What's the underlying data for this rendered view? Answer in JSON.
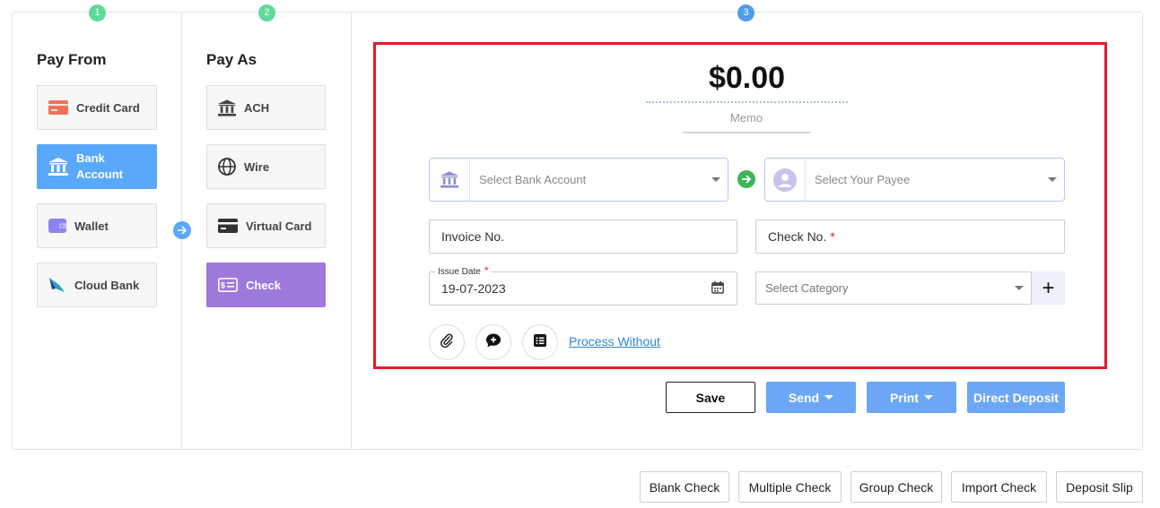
{
  "steps": [
    "1",
    "2",
    "3"
  ],
  "pay_from": {
    "title": "Pay From",
    "options": [
      {
        "label": "Credit Card",
        "icon": "credit-card-icon"
      },
      {
        "label_line1": "Bank",
        "label_line2": "Account",
        "icon": "bank-icon",
        "selected": true
      },
      {
        "label": "Wallet",
        "icon": "wallet-icon"
      },
      {
        "label": "Cloud Bank",
        "icon": "cloud-bank-icon"
      }
    ]
  },
  "pay_as": {
    "title": "Pay As",
    "options": [
      {
        "label": "ACH",
        "icon": "bank-icon"
      },
      {
        "label": "Wire",
        "icon": "globe-icon"
      },
      {
        "label": "Virtual Card",
        "icon": "card-icon"
      },
      {
        "label": "Check",
        "icon": "check-icon",
        "selected": true
      }
    ]
  },
  "form": {
    "amount": "$0.00",
    "memo_placeholder": "Memo",
    "bank_account_placeholder": "Select Bank Account",
    "payee_placeholder": "Select Your Payee",
    "invoice_placeholder": "Invoice No.",
    "check_no_placeholder": "Check No.",
    "required_mark": "*",
    "issue_date_label": "Issue Date",
    "issue_date_value": "19-07-2023",
    "category_placeholder": "Select Category",
    "add_category": "+",
    "process_without": "Process Without"
  },
  "actions": {
    "save": "Save",
    "send": "Send",
    "print": "Print",
    "direct_deposit": "Direct Deposit"
  },
  "bottom_buttons": [
    "Blank Check",
    "Multiple Check",
    "Group Check",
    "Import Check",
    "Deposit Slip"
  ],
  "colors": {
    "accent_blue": "#5aa8fb",
    "accent_purple": "#9d79dc",
    "step_green": "#5ed99a",
    "highlight_red": "#e11b2a"
  }
}
